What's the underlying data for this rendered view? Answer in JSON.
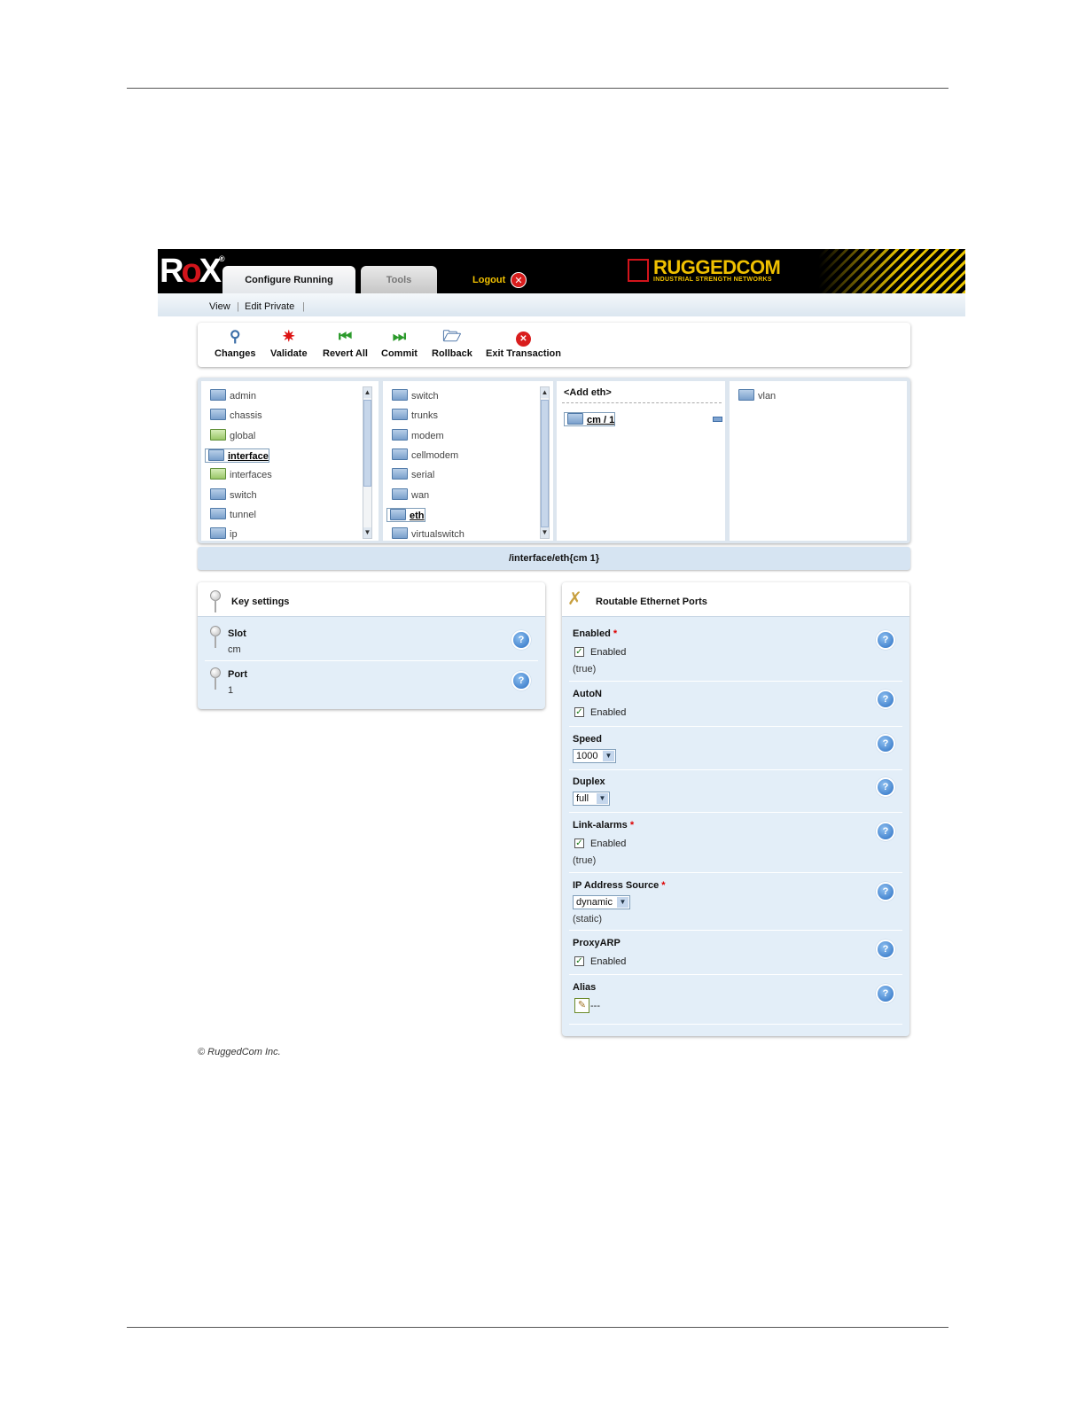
{
  "header": {
    "logo_text": "ROX",
    "tabs": [
      {
        "label": "Configure Running"
      },
      {
        "label": "Tools"
      }
    ],
    "logout_label": "Logout",
    "brand_name": "RUGGEDCOM",
    "brand_tagline": "INDUSTRIAL STRENGTH NETWORKS"
  },
  "subnav": {
    "view_label": "View",
    "edit_label": "Edit Private"
  },
  "toolbar": {
    "buttons": [
      {
        "label": "Changes",
        "icon": "magnifier-icon"
      },
      {
        "label": "Validate",
        "icon": "validate-icon"
      },
      {
        "label": "Revert All",
        "icon": "revert-icon"
      },
      {
        "label": "Commit",
        "icon": "commit-icon"
      },
      {
        "label": "Rollback",
        "icon": "rollback-icon"
      },
      {
        "label": "Exit Transaction",
        "icon": "exit-icon"
      }
    ]
  },
  "browser": {
    "col1": [
      "admin",
      "chassis",
      "global",
      "interface",
      "interfaces",
      "switch",
      "tunnel",
      "ip"
    ],
    "col2": [
      "switch",
      "trunks",
      "modem",
      "cellmodem",
      "serial",
      "wan",
      "eth",
      "virtualswitch"
    ],
    "col3_header": "<Add eth>",
    "col3_item": "cm / 1",
    "col4": [
      "vlan"
    ],
    "path": "/interface/eth{cm 1}"
  },
  "key_settings": {
    "title": "Key settings",
    "slot_label": "Slot",
    "slot_value": "cm",
    "port_label": "Port",
    "port_value": "1"
  },
  "routable": {
    "title": "Routable Ethernet Ports",
    "enabled_label": "Enabled",
    "enabled_check": "Enabled",
    "enabled_default": "(true)",
    "auton_label": "AutoN",
    "auton_check": "Enabled",
    "speed_label": "Speed",
    "speed_value": "1000",
    "duplex_label": "Duplex",
    "duplex_value": "full",
    "linkalarms_label": "Link-alarms",
    "linkalarms_check": "Enabled",
    "linkalarms_default": "(true)",
    "ipsource_label": "IP Address Source",
    "ipsource_value": "dynamic",
    "ipsource_default": "(static)",
    "proxyarp_label": "ProxyARP",
    "proxyarp_check": "Enabled",
    "alias_label": "Alias",
    "alias_value": "---"
  },
  "footer": "© RuggedCom Inc."
}
